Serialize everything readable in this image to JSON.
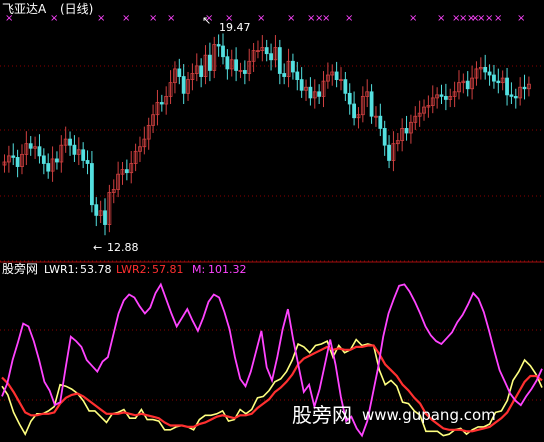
{
  "top_panel": {
    "title": "飞亚达A",
    "period": "(日线)",
    "high_label": "19.47",
    "low_label": "12.88",
    "signal_marker": "×"
  },
  "bottom_panel": {
    "indicator_name": "股旁网",
    "lwr1_label": "LWR1:",
    "lwr1_value": "53.78",
    "lwr2_label": "LWR2:",
    "lwr2_value": "57.81",
    "m_label": "M:",
    "m_value": "101.32"
  },
  "watermark": {
    "text_cn": "股旁网",
    "url": "www.gupang.com"
  },
  "colors": {
    "background": "#000000",
    "grid": "#8b0000",
    "up_candle": "#d04040",
    "down_candle": "#54e0e0",
    "title": "#ffffff",
    "lwr1": "#ffff80",
    "lwr2": "#ff3030",
    "m_line": "#ff44ff",
    "signal": "#ff44ff"
  },
  "chart_data": [
    {
      "type": "candlestick",
      "title": "飞亚达A (日线)",
      "ylim": [
        12.4,
        20.2
      ],
      "annotations": [
        "19.47",
        "12.88"
      ],
      "series": [
        {
          "name": "close",
          "values": [
            15.35,
            15.55,
            15.5,
            15.2,
            15.6,
            15.95,
            15.8,
            15.85,
            15.55,
            15.3,
            15.05,
            15.45,
            15.35,
            15.9,
            16.1,
            15.9,
            15.6,
            15.75,
            15.4,
            15.3,
            13.95,
            13.6,
            13.75,
            13.3,
            14.35,
            14.45,
            14.95,
            15.1,
            15.0,
            15.3,
            15.7,
            15.85,
            16.1,
            16.55,
            16.9,
            17.3,
            17.25,
            17.5,
            17.95,
            18.4,
            18.15,
            17.6,
            18.05,
            18.25,
            18.5,
            18.15,
            18.85,
            18.35,
            19.2,
            19.15,
            18.8,
            18.4,
            18.7,
            18.35,
            18.35,
            18.25,
            18.65,
            19.0,
            19.0,
            19.1,
            18.9,
            18.7,
            19.1,
            18.25,
            18.15,
            18.65,
            18.3,
            18.05,
            17.7,
            17.8,
            17.45,
            17.65,
            17.5,
            18.0,
            18.2,
            18.3,
            18.05,
            18.05,
            17.6,
            17.25,
            16.8,
            16.9,
            17.5,
            17.65,
            16.85,
            16.85,
            16.45,
            15.9,
            15.4,
            15.95,
            16.05,
            16.45,
            16.3,
            16.65,
            16.85,
            16.95,
            17.15,
            17.2,
            17.45,
            17.55,
            17.5,
            17.4,
            17.5,
            17.65,
            17.95,
            18.0,
            17.75,
            18.1,
            18.4,
            18.45,
            18.3,
            18.2,
            18.0,
            17.95,
            18.1,
            17.55,
            17.5,
            17.45,
            17.8,
            17.75,
            17.9
          ]
        }
      ]
    },
    {
      "type": "line",
      "title": "股旁网",
      "ylim": [
        0,
        110
      ],
      "series": [
        {
          "name": "LWR1",
          "values": [
            37.0,
            31.0,
            19.0,
            11.0,
            4.0,
            13.0,
            18.0,
            18.0,
            20.0,
            23.0,
            38.0,
            37.0,
            35.0,
            32.0,
            27.0,
            20.0,
            20.0,
            16.0,
            12.0,
            18.0,
            19.0,
            21.0,
            15.0,
            15.0,
            21.0,
            14.0,
            14.0,
            13.0,
            7.0,
            7.0,
            9.0,
            10.0,
            9.0,
            7.0,
            14.0,
            17.0,
            17.0,
            18.0,
            20.0,
            13.0,
            14.0,
            21.0,
            18.0,
            21.0,
            29.0,
            30.0,
            34.0,
            40.0,
            42.0,
            47.0,
            55.0,
            66.0,
            64.0,
            60.0,
            65.0,
            66.0,
            68.0,
            57.0,
            65.0,
            60.0,
            62.0,
            69.0,
            65.0,
            66.0,
            65.0,
            48.0,
            38.0,
            41.0,
            37.0,
            26.0,
            25.0,
            20.0,
            17.0,
            6.0,
            6.0,
            6.0,
            3.0,
            4.0,
            7.0,
            8.0,
            4.0,
            7.0,
            9.0,
            9.0,
            11.0,
            19.0,
            20.0,
            27.0,
            41.0,
            47.0,
            55.0,
            51.0,
            45.0,
            36.0
          ]
        },
        {
          "name": "LWR2",
          "values": [
            43.0,
            39.0,
            33.0,
            26.0,
            19.0,
            17.0,
            17.0,
            18.0,
            18.0,
            19.0,
            25.0,
            29.0,
            31.0,
            32.0,
            30.0,
            27.0,
            24.0,
            21.0,
            18.0,
            18.0,
            18.0,
            19.0,
            18.0,
            17.0,
            18.0,
            17.0,
            16.0,
            15.0,
            12.0,
            10.0,
            10.0,
            10.0,
            9.0,
            9.0,
            11.0,
            12.0,
            14.0,
            16.0,
            17.0,
            16.0,
            15.0,
            17.0,
            17.0,
            18.0,
            22.0,
            25.0,
            28.0,
            33.0,
            36.0,
            40.0,
            45.0,
            52.0,
            56.0,
            58.0,
            60.0,
            62.0,
            64.0,
            62.0,
            63.0,
            62.0,
            62.0,
            64.0,
            64.0,
            65.0,
            65.0,
            59.0,
            52.0,
            48.0,
            44.0,
            38.0,
            34.0,
            29.0,
            25.0,
            18.0,
            14.0,
            11.0,
            8.0,
            7.0,
            7.0,
            7.0,
            6.0,
            6.0,
            7.0,
            8.0,
            9.0,
            12.0,
            15.0,
            19.0,
            26.0,
            33.0,
            40.0,
            44.0,
            44.0,
            41.0
          ]
        },
        {
          "name": "M",
          "values": [
            30.0,
            39.0,
            55.0,
            67.0,
            80.0,
            78.0,
            68.0,
            55.0,
            40.0,
            34.0,
            24.0,
            26.0,
            49.0,
            71.0,
            68.0,
            64.0,
            55.0,
            51.0,
            47.0,
            54.0,
            57.0,
            72.0,
            87.0,
            96.0,
            100.0,
            98.0,
            92.0,
            87.0,
            91.0,
            101.0,
            107.0,
            97.0,
            87.0,
            78.0,
            84.0,
            90.0,
            82.0,
            75.0,
            84.0,
            95.0,
            100.0,
            98.0,
            88.0,
            76.0,
            57.0,
            42.0,
            37.0,
            47.0,
            61.0,
            75.0,
            50.0,
            41.0,
            57.0,
            76.0,
            90.0,
            69.0,
            51.0,
            33.0,
            38.0,
            23.0,
            35.0,
            52.0,
            69.0,
            52.0,
            30.0,
            13.0,
            16.0,
            8.0,
            3.0,
            13.0,
            31.0,
            49.0,
            71.0,
            87.0,
            97.0,
            106.0,
            107.0,
            102.0,
            95.0,
            87.0,
            78.0,
            72.0,
            68.0,
            66.0,
            70.0,
            74.0,
            81.0,
            86.0,
            93.0,
            101.0,
            97.0,
            88.0,
            75.0,
            61.0,
            48.0,
            40.0,
            32.0,
            27.0,
            24.0,
            30.0,
            35.0,
            41.0,
            49.0
          ]
        }
      ]
    }
  ],
  "signals_x": [
    8,
    53,
    100,
    125,
    152,
    170,
    208,
    228,
    260,
    290,
    310,
    318,
    325,
    348,
    412,
    440,
    455,
    462,
    470,
    474,
    480,
    488,
    497,
    520
  ]
}
